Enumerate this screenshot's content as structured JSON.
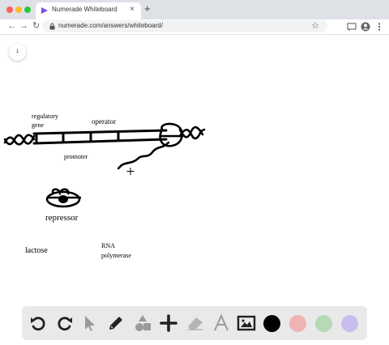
{
  "browser": {
    "tab_title": "Numerade Whiteboard",
    "url": "numerade.com/answers/whiteboard/"
  },
  "whiteboard": {
    "page_number": "1",
    "labels": {
      "regulatory_1": "regulatory",
      "regulatory_2": "gene",
      "operator": "operator",
      "promoter": "promoter",
      "repressor": "repressor",
      "lactose": "lactose",
      "rna_1": "RNA",
      "rna_2": "polymerase"
    }
  },
  "drawing_tools": {
    "colors": {
      "black": "#000000",
      "red": "#f0b3b3",
      "green": "#b6d9b6",
      "purple": "#c9bcef"
    }
  }
}
